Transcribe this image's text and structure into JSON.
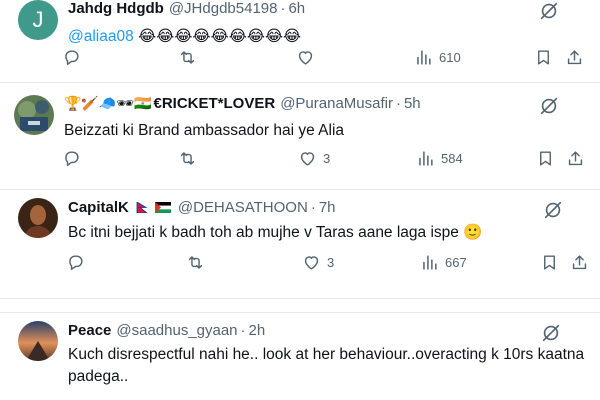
{
  "tweets": [
    {
      "avatar_letter": "J",
      "name": "Jahdg Hdgdb",
      "handle": "@JHdgdb54198",
      "time": "6h",
      "mention": "@aliaa08",
      "emoji_text": "😂😂😂😂😂😂😂😂😂",
      "views": "610"
    },
    {
      "name_prefix_emojis": "🏆🏏🧢🕶🇮🇳",
      "name": "€RICKET*LOVER",
      "handle": "@PuranaMusafir",
      "time": "5h",
      "text": "Beizzati ki Brand ambassador hai ye Alia",
      "likes": "3",
      "views": "584"
    },
    {
      "name": "CapitalK",
      "handle": "@DEHASATHOON",
      "time": "7h",
      "text": "Bc itni bejjati k badh toh ab mujhe v Taras aane laga ispe 🙂",
      "likes": "3",
      "views": "667"
    },
    {
      "name": "Peace",
      "handle": "@saadhus_gyaan",
      "time": "2h",
      "text_line1": "Kuch disrespectful nahi he.. look at her behaviour..overacting k 10rs kaatna",
      "text_line2": "padega.."
    }
  ],
  "separator": "·",
  "colors": {
    "text": "#0f1419",
    "secondary": "#536471",
    "link": "#1d9bf0",
    "divider": "#e6e9ec"
  },
  "icons": [
    "reply-icon",
    "retweet-icon",
    "like-icon",
    "views-icon",
    "bookmark-icon",
    "share-icon",
    "grok-icon"
  ]
}
